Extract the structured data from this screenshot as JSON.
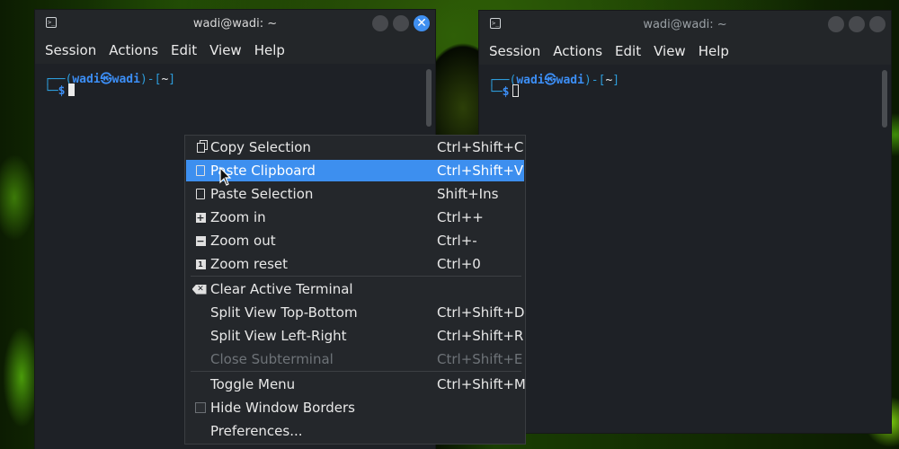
{
  "windows": [
    {
      "title": "wadi@wadi: ~",
      "menu": [
        "Session",
        "Actions",
        "Edit",
        "View",
        "Help"
      ],
      "prompt_user": "wadi",
      "prompt_host": "wadi",
      "prompt_dir": "~",
      "prompt_symbol": "$"
    },
    {
      "title": "wadi@wadi: ~",
      "menu": [
        "Session",
        "Actions",
        "Edit",
        "View",
        "Help"
      ],
      "prompt_user": "wadi",
      "prompt_host": "wadi",
      "prompt_dir": "~",
      "prompt_symbol": "$"
    }
  ],
  "context_menu": [
    {
      "label": "Copy Selection",
      "shortcut": "Ctrl+Shift+C",
      "icon": "copy-icon"
    },
    {
      "label": "Paste Clipboard",
      "shortcut": "Ctrl+Shift+V",
      "icon": "paste-icon",
      "highlighted": true
    },
    {
      "label": "Paste Selection",
      "shortcut": "Shift+Ins",
      "icon": "paste-icon"
    },
    {
      "label": "Zoom in",
      "shortcut": "Ctrl++",
      "icon": "zoom-in-icon"
    },
    {
      "label": "Zoom out",
      "shortcut": "Ctrl+-",
      "icon": "zoom-out-icon"
    },
    {
      "label": "Zoom reset",
      "shortcut": "Ctrl+0",
      "icon": "zoom-reset-icon"
    },
    {
      "label": "Clear Active Terminal",
      "shortcut": "",
      "icon": "clear-icon"
    },
    {
      "label": "Split View Top-Bottom",
      "shortcut": "Ctrl+Shift+D"
    },
    {
      "label": "Split View Left-Right",
      "shortcut": "Ctrl+Shift+R"
    },
    {
      "label": "Close Subterminal",
      "shortcut": "Ctrl+Shift+E",
      "disabled": true
    },
    {
      "label": "Toggle Menu",
      "shortcut": "Ctrl+Shift+M"
    },
    {
      "label": "Hide Window Borders",
      "shortcut": "",
      "icon": "checkbox-icon"
    },
    {
      "label": "Preferences...",
      "shortcut": ""
    }
  ],
  "colors": {
    "accent": "#3d8fef",
    "prompt_blue": "#3c8ef5"
  }
}
